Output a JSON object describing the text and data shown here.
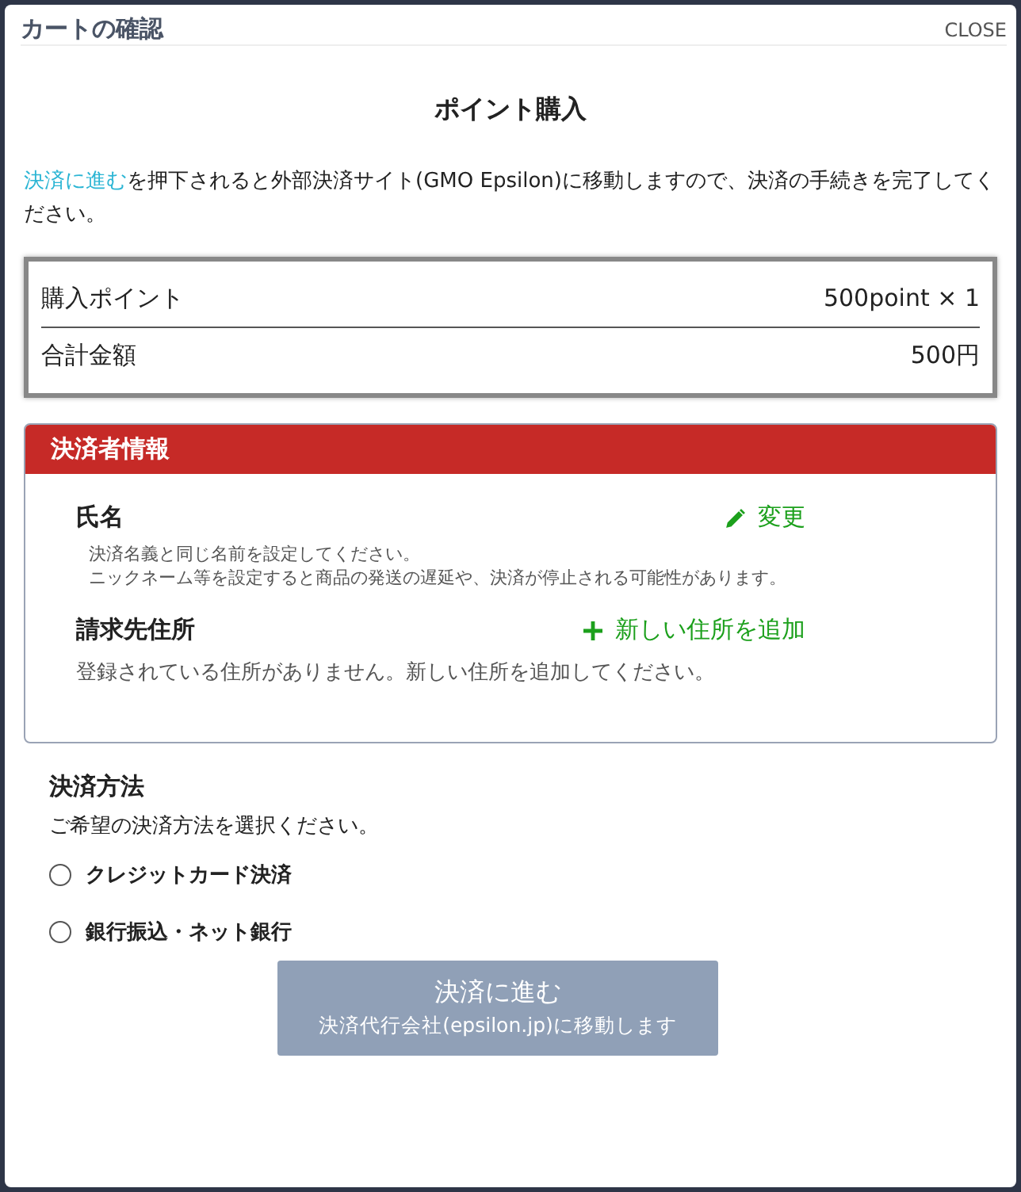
{
  "dialog": {
    "title": "カートの確認",
    "close": "CLOSE"
  },
  "heading": "ポイント購入",
  "notice": {
    "link": "決済に進む",
    "text": "を押下されると外部決済サイト(GMO Epsilon)に移動しますので、決済の手続きを完了してください。"
  },
  "summary": [
    {
      "label": "購入ポイント",
      "value": "500point × 1"
    },
    {
      "label": "合計金額",
      "value": "500円"
    }
  ],
  "payer": {
    "title": "決済者情報",
    "sections": [
      {
        "kind": "name",
        "label": "氏名",
        "action": "変更",
        "notes": [
          "決済名義と同じ名前を設定してください。",
          "ニックネーム等を設定すると商品の発送の遅延や、決済が停止される可能性があります。"
        ]
      },
      {
        "kind": "address",
        "label": "請求先住所",
        "action": "新しい住所を追加",
        "notes": [
          "登録されている住所がありません。新しい住所を追加してください。"
        ]
      }
    ]
  },
  "payment": {
    "title": "決済方法",
    "hint": "ご希望の決済方法を選択ください。",
    "options": [
      {
        "label": "クレジットカード決済",
        "selected": false
      },
      {
        "label": "銀行振込・ネット銀行",
        "selected": false
      }
    ]
  },
  "submit": {
    "label": "決済に進む",
    "sub": "決済代行会社(epsilon.jp)に移動します",
    "disabled": true
  }
}
